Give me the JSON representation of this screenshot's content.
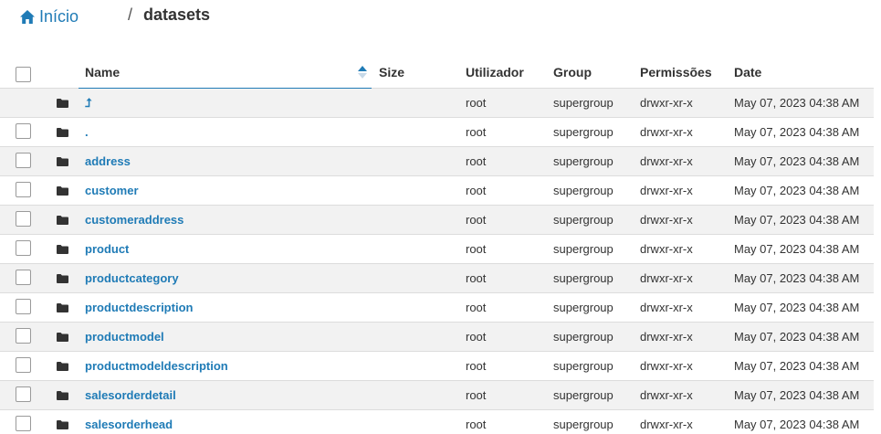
{
  "breadcrumb": {
    "home_label": "Início",
    "separator": "/",
    "current": "datasets"
  },
  "table": {
    "columns": {
      "name": "Name",
      "size": "Size",
      "user": "Utilizador",
      "group": "Group",
      "permissions": "Permissões",
      "date": "Date"
    },
    "sort": {
      "column": "name",
      "direction": "ascending"
    },
    "rows": [
      {
        "name": "⮥",
        "size": "",
        "user": "root",
        "group": "supergroup",
        "permissions": "drwxr-xr-x",
        "date": "May 07, 2023 04:38 AM",
        "checkbox": false
      },
      {
        "name": ".",
        "size": "",
        "user": "root",
        "group": "supergroup",
        "permissions": "drwxr-xr-x",
        "date": "May 07, 2023 04:38 AM",
        "checkbox": true
      },
      {
        "name": "address",
        "size": "",
        "user": "root",
        "group": "supergroup",
        "permissions": "drwxr-xr-x",
        "date": "May 07, 2023 04:38 AM",
        "checkbox": true
      },
      {
        "name": "customer",
        "size": "",
        "user": "root",
        "group": "supergroup",
        "permissions": "drwxr-xr-x",
        "date": "May 07, 2023 04:38 AM",
        "checkbox": true
      },
      {
        "name": "customeraddress",
        "size": "",
        "user": "root",
        "group": "supergroup",
        "permissions": "drwxr-xr-x",
        "date": "May 07, 2023 04:38 AM",
        "checkbox": true
      },
      {
        "name": "product",
        "size": "",
        "user": "root",
        "group": "supergroup",
        "permissions": "drwxr-xr-x",
        "date": "May 07, 2023 04:38 AM",
        "checkbox": true
      },
      {
        "name": "productcategory",
        "size": "",
        "user": "root",
        "group": "supergroup",
        "permissions": "drwxr-xr-x",
        "date": "May 07, 2023 04:38 AM",
        "checkbox": true
      },
      {
        "name": "productdescription",
        "size": "",
        "user": "root",
        "group": "supergroup",
        "permissions": "drwxr-xr-x",
        "date": "May 07, 2023 04:38 AM",
        "checkbox": true
      },
      {
        "name": "productmodel",
        "size": "",
        "user": "root",
        "group": "supergroup",
        "permissions": "drwxr-xr-x",
        "date": "May 07, 2023 04:38 AM",
        "checkbox": true
      },
      {
        "name": "productmodeldescription",
        "size": "",
        "user": "root",
        "group": "supergroup",
        "permissions": "drwxr-xr-x",
        "date": "May 07, 2023 04:38 AM",
        "checkbox": true
      },
      {
        "name": "salesorderdetail",
        "size": "",
        "user": "root",
        "group": "supergroup",
        "permissions": "drwxr-xr-x",
        "date": "May 07, 2023 04:38 AM",
        "checkbox": true
      },
      {
        "name": "salesorderhead",
        "size": "",
        "user": "root",
        "group": "supergroup",
        "permissions": "drwxr-xr-x",
        "date": "May 07, 2023 04:38 AM",
        "checkbox": true
      }
    ]
  },
  "icons": {
    "home": "home-icon",
    "folder": "folder-icon",
    "sort": "sort-ascending-icon"
  },
  "colors": {
    "link": "#1f7bb6",
    "row_alt": "#f2f2f2",
    "border": "#dcdcdc",
    "folder": "#333333"
  }
}
